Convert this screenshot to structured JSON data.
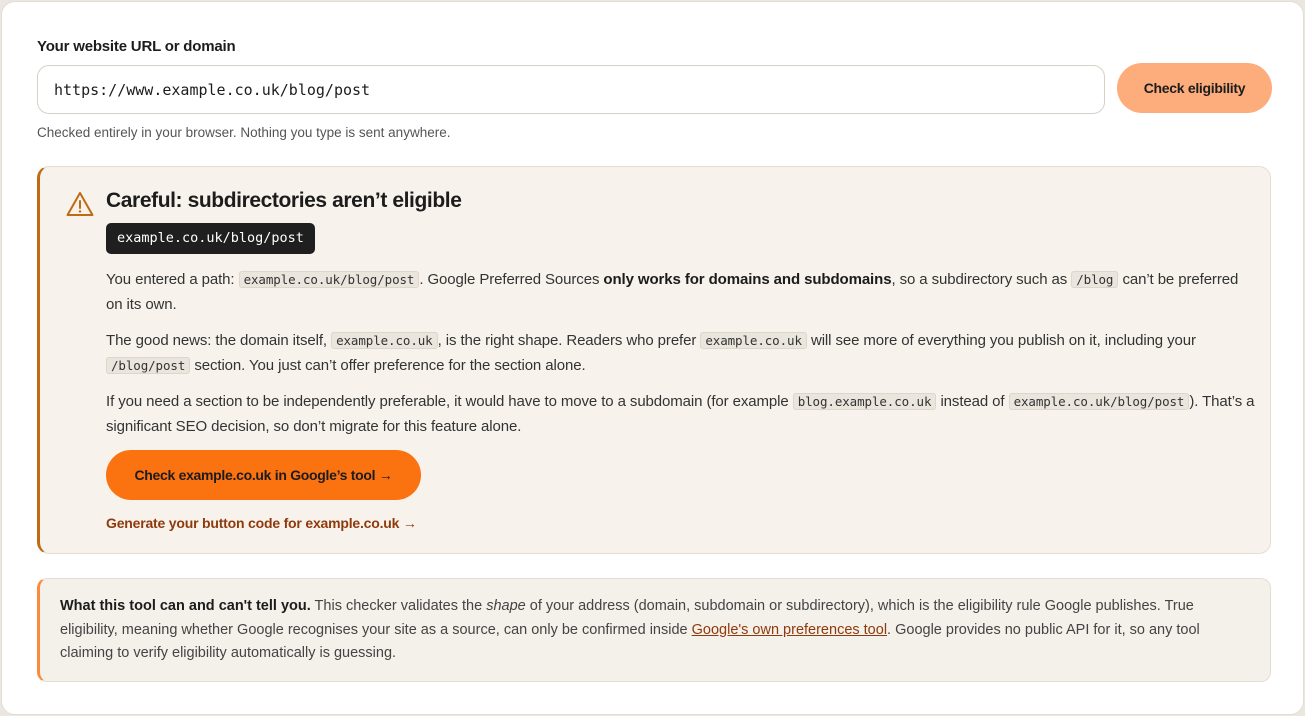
{
  "form": {
    "label": "Your website URL or domain",
    "input_value": "https://www.example.co.uk/blog/post",
    "button_label": "Check eligibility",
    "privacy_note": "Checked entirely in your browser. Nothing you type is sent anywhere."
  },
  "warning": {
    "icon": "warning-triangle-icon",
    "title": "Careful: subdirectories aren’t eligible",
    "path_chip": "example.co.uk/blog/post",
    "p1": {
      "t1": "You entered a path: ",
      "code1": "example.co.uk/blog/post",
      "t2": ". Google Preferred Sources ",
      "bold": "only works for domains and subdomains",
      "t3": ", so a subdirectory such as ",
      "code2": "/blog",
      "t4": " can’t be preferred on its own."
    },
    "p2": {
      "t1": "The good news: the domain itself, ",
      "code1": "example.co.uk",
      "t2": ", is the right shape. Readers who prefer ",
      "code2": "example.co.uk",
      "t3": " will see more of everything you publish on it, including your ",
      "code3": "/blog/post",
      "t4": " section. You just can’t offer preference for the section alone."
    },
    "p3": {
      "t1": "If you need a section to be independently preferable, it would have to move to a subdomain (for example ",
      "code1": "blog.example.co.uk",
      "t2": " instead of ",
      "code2": "example.co.uk/blog/post",
      "t3": "). That’s a significant SEO decision, so don’t migrate for this feature alone."
    },
    "google_button": "Check example.co.uk in Google’s tool →",
    "generate_link": "Generate your button code for example.co.uk →"
  },
  "info": {
    "bold": "What this tool can and can't tell you.",
    "t1": " This checker validates the ",
    "em": "shape",
    "t2": " of your address (domain, subdomain or subdirectory), which is the eligibility rule Google publishes. True eligibility, meaning whether Google recognises your site as a source, can only be confirmed inside ",
    "link": "Google's own preferences tool",
    "t3": ". Google provides no public API for it, so any tool claiming to verify eligibility automatically is guessing."
  },
  "colors": {
    "accent": "#fb7211",
    "accent_light": "#fdad7c",
    "warning_border": "#c06a12",
    "link": "#8f3a0c"
  }
}
